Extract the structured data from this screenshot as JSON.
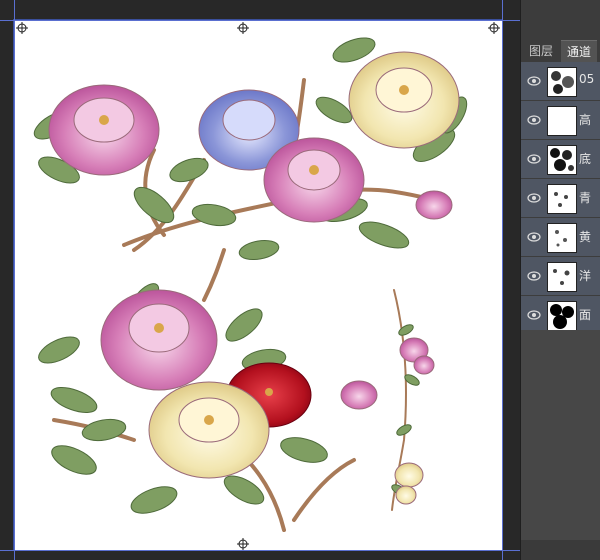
{
  "panel": {
    "tabs": [
      {
        "label": "图层"
      },
      {
        "label": "通道"
      }
    ],
    "active_tab": "通道",
    "channels": [
      {
        "label": "05",
        "thumbnail": "mixed"
      },
      {
        "label": "高",
        "thumbnail": "white"
      },
      {
        "label": "底",
        "thumbnail": "dense"
      },
      {
        "label": "青",
        "thumbnail": "sparse"
      },
      {
        "label": "黄",
        "thumbnail": "sparse"
      },
      {
        "label": "洋",
        "thumbnail": "sparse"
      },
      {
        "label": "面",
        "thumbnail": "black"
      }
    ]
  },
  "colors": {
    "workspace": "#282828",
    "panel": "#535353",
    "row_highlight": "#4f5663",
    "guide": "#5a6fd0",
    "peony_pink": "#d77fb8",
    "peony_blue": "#8b96d8",
    "peony_cream": "#f2e6b0",
    "peony_red": "#b3101e",
    "leaf_green": "#6f8f55"
  },
  "icons": [
    "eye-icon",
    "crosshair-handle-icon"
  ]
}
